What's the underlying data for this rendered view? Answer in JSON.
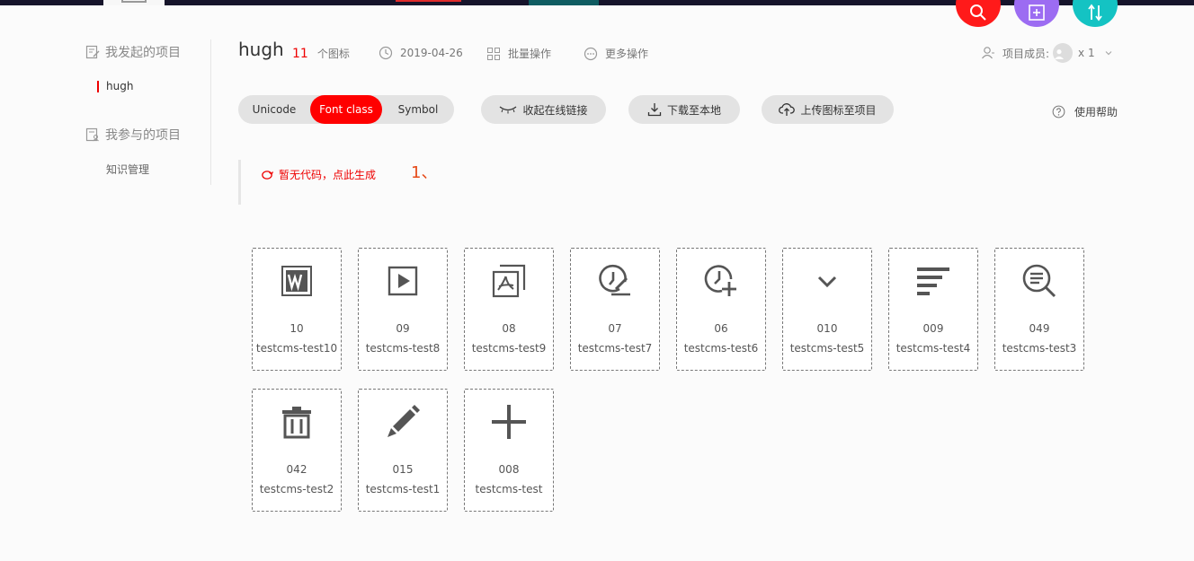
{
  "sidebar": {
    "my_projects": "我发起的项目",
    "my_projects_items": [
      "hugh"
    ],
    "joined_projects": "我参与的项目",
    "joined_projects_items": [
      "知识管理"
    ]
  },
  "header": {
    "project_name": "hugh",
    "icon_count": "11",
    "icon_count_suffix": "个图标",
    "date": "2019-04-26",
    "batch": "批量操作",
    "more": "更多操作",
    "members_label": "项目成员:",
    "members_count": "x 1"
  },
  "tabs": [
    "Unicode",
    "Font class",
    "Symbol"
  ],
  "active_tab": "Font class",
  "actions": {
    "collapse_link": "收起在线链接",
    "download": "下载至本地",
    "upload": "上传图标至项目",
    "help": "使用帮助"
  },
  "code": {
    "generate": "暂无代码，点此生成",
    "note": "1、"
  },
  "icons": [
    {
      "code": "10",
      "name": "testcms-test10",
      "icon": "word-doc-icon"
    },
    {
      "code": "09",
      "name": "testcms-test8",
      "icon": "play-box-icon"
    },
    {
      "code": "08",
      "name": "testcms-test9",
      "icon": "pdf-image-icon"
    },
    {
      "code": "07",
      "name": "testcms-test7",
      "icon": "clock-edit-icon"
    },
    {
      "code": "06",
      "name": "testcms-test6",
      "icon": "clock-add-icon"
    },
    {
      "code": "010",
      "name": "testcms-test5",
      "icon": "chevron-down-icon"
    },
    {
      "code": "009",
      "name": "testcms-test4",
      "icon": "align-left-icon"
    },
    {
      "code": "049",
      "name": "testcms-test3",
      "icon": "search-list-icon"
    },
    {
      "code": "042",
      "name": "testcms-test2",
      "icon": "trash-icon"
    },
    {
      "code": "015",
      "name": "testcms-test1",
      "icon": "pencil-icon"
    },
    {
      "code": "008",
      "name": "testcms-test",
      "icon": "plus-icon"
    }
  ],
  "colors": {
    "accent": "#ff0000",
    "search_fab": "#ff1a1a",
    "add_fab": "#9c6cf2",
    "sort_fab": "#14c3c3"
  }
}
